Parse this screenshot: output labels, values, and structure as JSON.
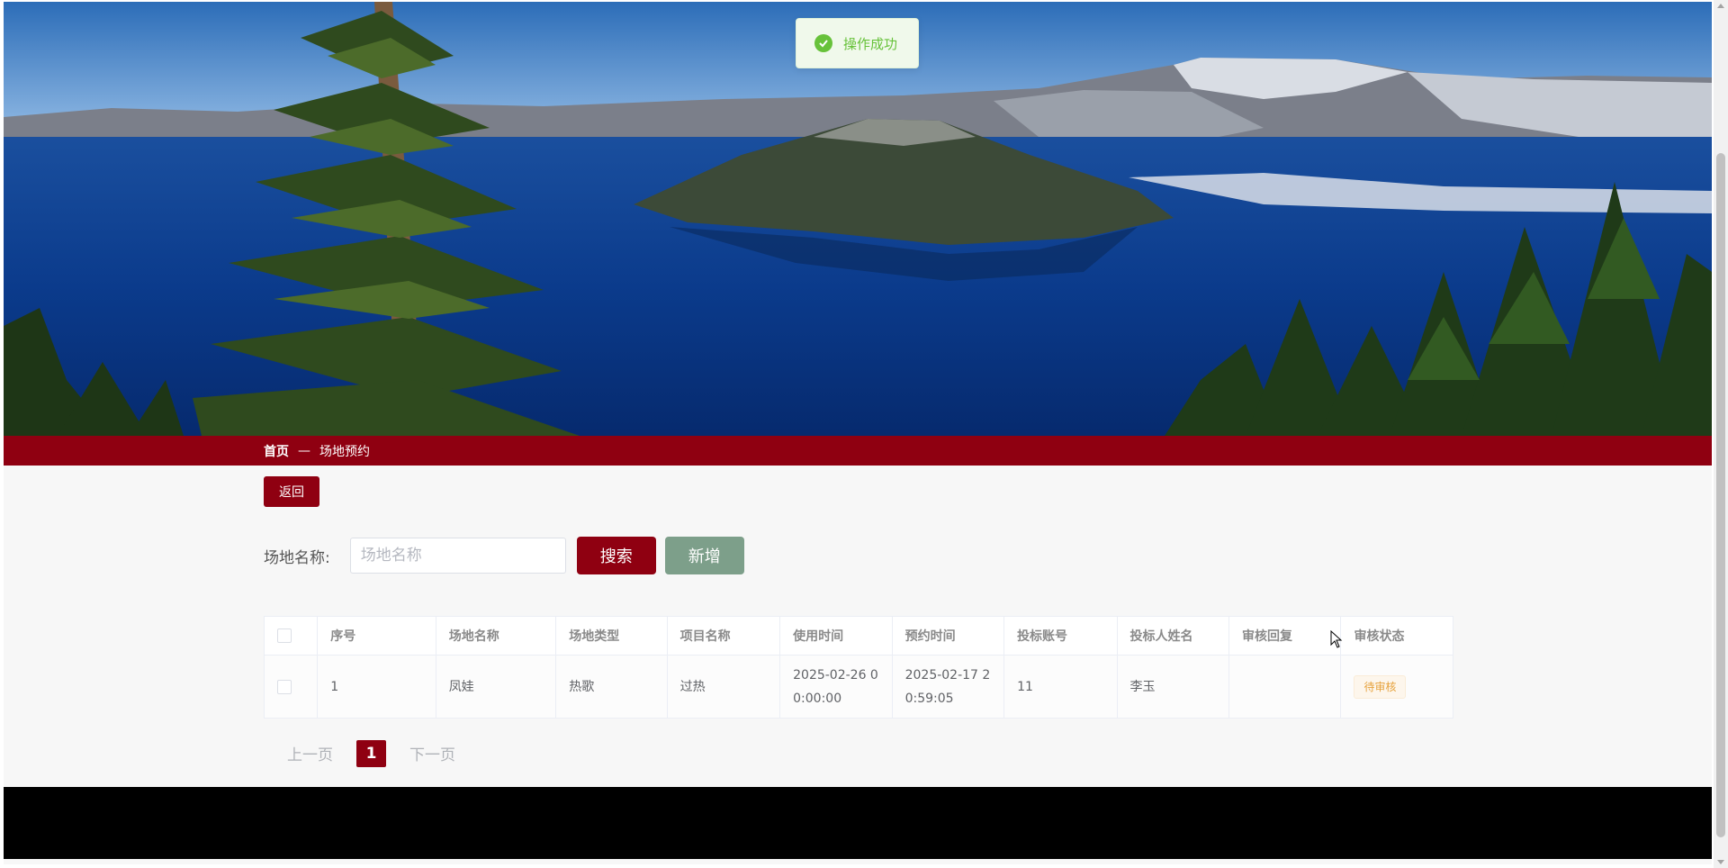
{
  "toast": {
    "message": "操作成功",
    "icon": "check-circle-icon",
    "color": "#67c23a"
  },
  "breadcrumb": {
    "home": "首页",
    "separator": "—",
    "current": "场地预约"
  },
  "back_button": {
    "label": "返回"
  },
  "search": {
    "label": "场地名称:",
    "placeholder": "场地名称",
    "value": "",
    "search_label": "搜索",
    "add_label": "新增"
  },
  "table": {
    "headers": [
      "序号",
      "场地名称",
      "场地类型",
      "项目名称",
      "使用时间",
      "预约时间",
      "投标账号",
      "投标人姓名",
      "审核回复",
      "审核状态"
    ],
    "rows": [
      {
        "index": "1",
        "venue_name": "凤娃",
        "venue_type": "热歌",
        "project_name": "过热",
        "use_time": "2025-02-26 00:00:00",
        "booking_time": "2025-02-17 20:59:05",
        "bid_account": "11",
        "bidder_name": "李玉",
        "review_reply": "",
        "review_status": "待审核"
      }
    ]
  },
  "pagination": {
    "prev": "上一页",
    "current": "1",
    "next": "下一页"
  },
  "colors": {
    "primary": "#8f0011",
    "add_button": "#7d9f8a",
    "footer": "#000000",
    "status_tag": "#e6a23c"
  }
}
